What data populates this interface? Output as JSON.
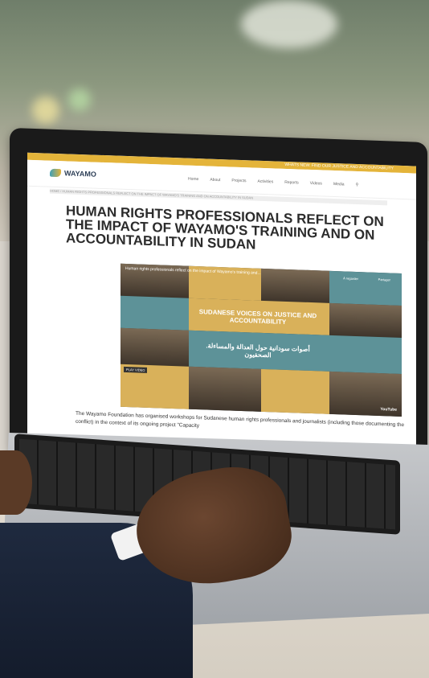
{
  "website": {
    "topbar_text": "WHATS NEW: FIND OUR JUSTICE AND ACCOUNTABILITY",
    "logo": "WAYAMO",
    "menu": [
      "Home",
      "About",
      "Projects",
      "Activities",
      "Reports",
      "Videos",
      "Media"
    ],
    "search_icon": "search-icon",
    "breadcrumb": "HOME / HUMAN RIGHTS PROFESSIONALS REFLECT ON THE IMPACT OF WAYAMO'S TRAINING AND ON ACCOUNTABILITY IN SUDAN",
    "headline": "HUMAN RIGHTS PROFESSIONALS REFLECT ON THE IMPACT OF WAYAMO'S TRAINING AND ON ACCOUNTABILITY IN SUDAN",
    "video": {
      "title": "Human rights professionals reflect on the impact of Wayamo's training and...",
      "en_title": "SUDANESE VOICES ON JUSTICE AND ACCOUNTABILITY",
      "ar_title": "أصوات سودانية حول العدالة والمساءلة. الصحفيون",
      "play_label": "PLAY VIDEO",
      "watch_later": "À regarder",
      "share": "Partager",
      "youtube": "YouTube"
    },
    "body_text": "The Wayamo Foundation has organised workshops for Sudanese human rights professionals and journalists (including those documenting the conflict) in the context of its ongoing project \"Capacity"
  },
  "colors": {
    "gold": "#e4b43a",
    "teal": "#5d9298",
    "navy": "#2d3f57"
  }
}
